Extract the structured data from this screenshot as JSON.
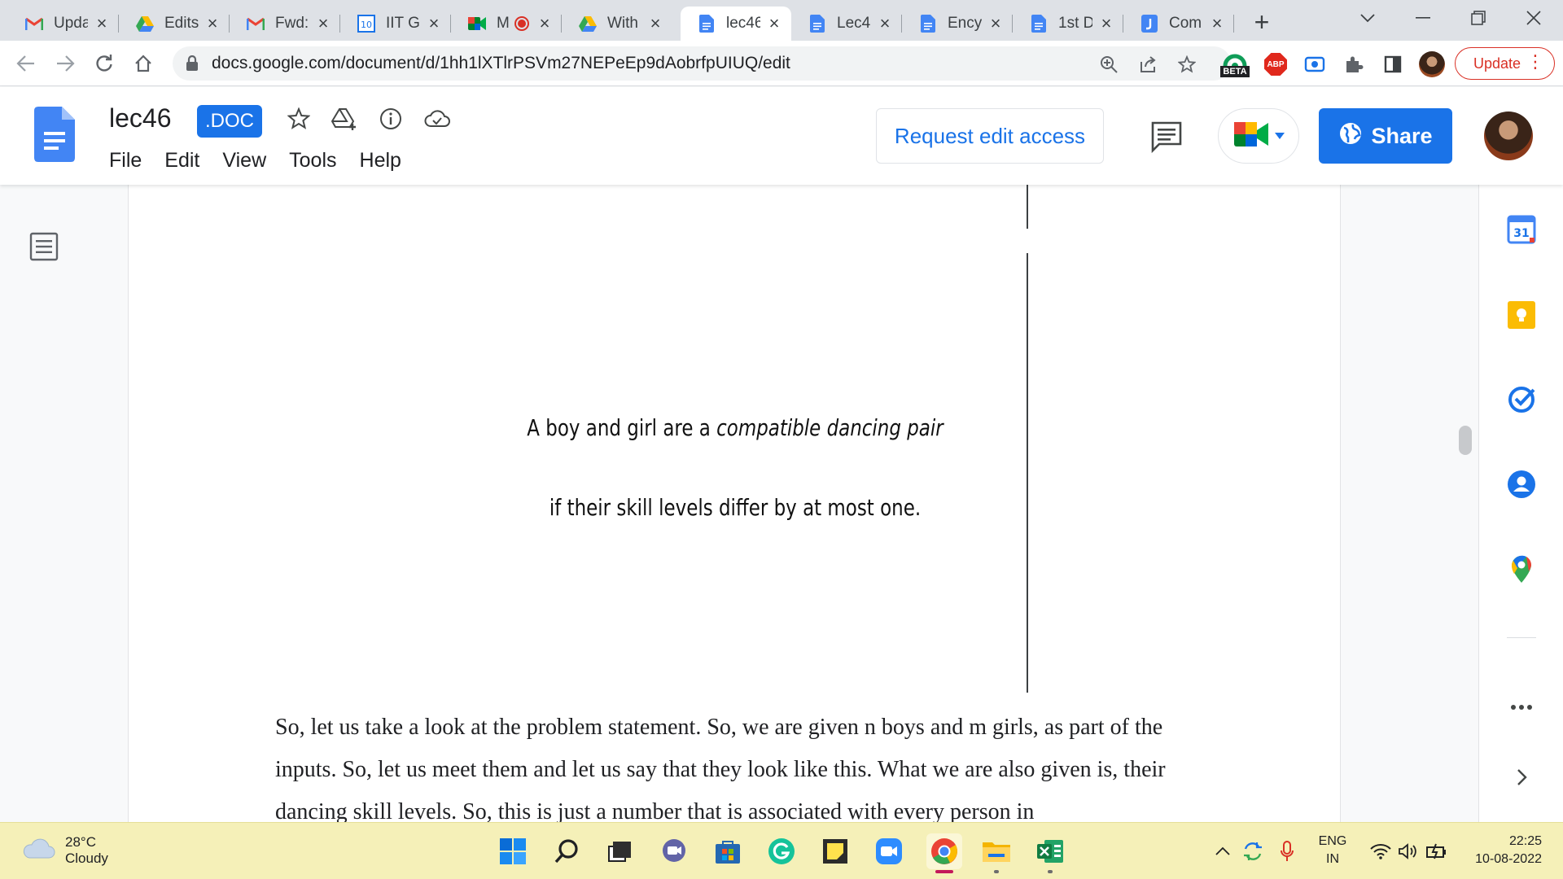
{
  "browser": {
    "tabs": [
      {
        "title": "Upda",
        "icon": "gmail-icon"
      },
      {
        "title": "Edits",
        "icon": "google-drive-icon"
      },
      {
        "title": "Fwd:",
        "icon": "gmail-icon"
      },
      {
        "title": "IIT G",
        "icon": "calendar-10-icon"
      },
      {
        "title": "M",
        "icon": "google-meet-icon"
      },
      {
        "title": "With",
        "icon": "google-drive-icon"
      },
      {
        "title": "lec46",
        "icon": "google-docs-icon",
        "active": true
      },
      {
        "title": "Lec4",
        "icon": "google-docs-icon"
      },
      {
        "title": "Ency",
        "icon": "google-docs-icon"
      },
      {
        "title": "1st D",
        "icon": "google-docs-icon"
      },
      {
        "title": "Com",
        "icon": "jamboard-icon"
      }
    ],
    "url": "docs.google.com/document/d/1hh1lXTlrPSVm27NEPeEp9dAobrfpUIUQ/edit",
    "update_label": "Update",
    "beta_label": "BETA",
    "abp_label": "ABP"
  },
  "docs": {
    "title": "lec46",
    "badge": ".DOC",
    "menu": [
      "File",
      "Edit",
      "View",
      "Tools",
      "Help"
    ],
    "request_edit_label": "Request edit access",
    "share_label": "Share"
  },
  "document": {
    "slide_line1_plain": "A boy and girl are a ",
    "slide_line1_italic": "compatible dancing pair",
    "slide_line2": "if their skill levels differ by at most one.",
    "paragraph": "So, let us take a look at the problem statement. So, we are given n boys and m girls, as part of the inputs. So, let us meet them and let us say that they look like this. What we are also given is, their dancing skill levels. So, this is just a number that is associated with every person in"
  },
  "sidepanel": {
    "calendar_day": "31"
  },
  "taskbar": {
    "temperature": "28°C",
    "weather": "Cloudy",
    "lang_top": "ENG",
    "lang_bottom": "IN",
    "time": "22:25",
    "date": "10-08-2022"
  },
  "colors": {
    "accent": "#1a73e8",
    "update_red": "#d93025",
    "taskbar_bg": "#f5f0b8"
  }
}
